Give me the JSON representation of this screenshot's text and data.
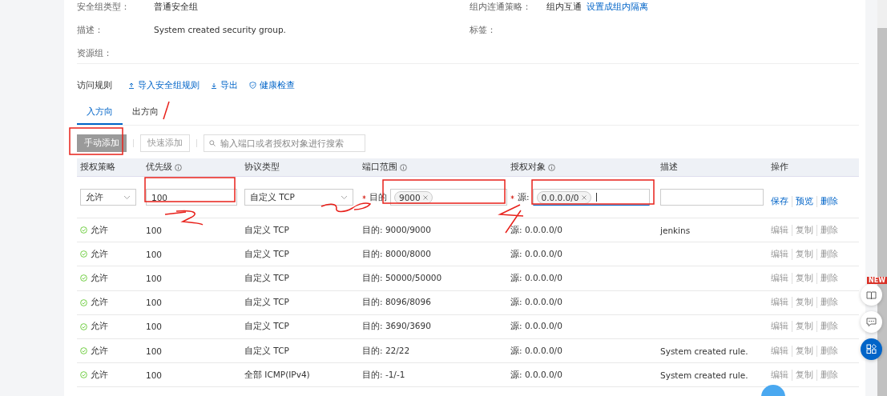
{
  "info": [
    {
      "label": "安全组类型：",
      "value": "普通安全组"
    },
    {
      "label": "组内连通策略：",
      "value": "组内互通",
      "link": "设置成组内隔离"
    },
    {
      "label": "描述：",
      "value": "System created security group."
    },
    {
      "label": "标签："
    },
    {
      "label": "资源组："
    }
  ],
  "rules": {
    "title": "访问规则",
    "actions": [
      {
        "kind": "upload",
        "label": "导入安全组规则"
      },
      {
        "kind": "download",
        "label": "导出"
      },
      {
        "kind": "shield",
        "label": "健康检查"
      }
    ]
  },
  "tabs": [
    {
      "label": "入方向",
      "selected": true
    },
    {
      "label": "出方向",
      "selected": false
    }
  ],
  "toolbar": {
    "buttons": [
      {
        "label": "手动添加",
        "disabled": true,
        "kind": "filled"
      },
      {
        "label": "快速添加",
        "disabled": true,
        "kind": "outline"
      }
    ],
    "search": {
      "placeholder": "输入端口或者授权对象进行搜索"
    }
  },
  "columns": [
    {
      "label": "授权策略",
      "info": false
    },
    {
      "label": "优先级",
      "info": true
    },
    {
      "label": "协议类型",
      "info": false
    },
    {
      "label": "端口范围",
      "info": true
    },
    {
      "label": "授权对象",
      "info": true
    },
    {
      "label": "描述",
      "info": false
    },
    {
      "label": "操作",
      "info": false
    }
  ],
  "edit_row": {
    "policy": "允许",
    "priority": "100",
    "protocol": "自定义 TCP",
    "port_required": true,
    "port_label": "目的",
    "source_required": true,
    "port_tag": "9000",
    "source_label": "源:",
    "source_tag": "0.0.0.0/0",
    "actions": [
      "保存",
      "预览",
      "删除"
    ]
  },
  "rows": [
    {
      "policy": "允许",
      "priority": "100",
      "protocol": "自定义 TCP",
      "port": "目的: 9000/9000",
      "source": "源: 0.0.0.0/0",
      "description": "jenkins",
      "actions": [
        {
          "label": "编辑",
          "disabled": true
        },
        {
          "label": "复制",
          "disabled": true
        },
        {
          "label": "删除",
          "disabled": true
        }
      ]
    },
    {
      "policy": "允许",
      "priority": "100",
      "protocol": "自定义 TCP",
      "port": "目的: 8000/8000",
      "source": "源: 0.0.0.0/0",
      "description": "",
      "actions": [
        {
          "label": "编辑",
          "disabled": true
        },
        {
          "label": "复制",
          "disabled": true
        },
        {
          "label": "删除",
          "disabled": true
        }
      ]
    },
    {
      "policy": "允许",
      "priority": "100",
      "protocol": "自定义 TCP",
      "port": "目的: 50000/50000",
      "source": "源: 0.0.0.0/0",
      "description": "",
      "actions": [
        {
          "label": "编辑",
          "disabled": true
        },
        {
          "label": "复制",
          "disabled": true
        },
        {
          "label": "删除",
          "disabled": true
        }
      ]
    },
    {
      "policy": "允许",
      "priority": "100",
      "protocol": "自定义 TCP",
      "port": "目的: 8096/8096",
      "source": "源: 0.0.0.0/0",
      "description": "",
      "actions": [
        {
          "label": "编辑",
          "disabled": true
        },
        {
          "label": "复制",
          "disabled": true
        },
        {
          "label": "删除",
          "disabled": true
        }
      ]
    },
    {
      "policy": "允许",
      "priority": "100",
      "protocol": "自定义 TCP",
      "port": "目的: 3690/3690",
      "source": "源: 0.0.0.0/0",
      "description": "",
      "actions": [
        {
          "label": "编辑",
          "disabled": true
        },
        {
          "label": "复制",
          "disabled": true
        },
        {
          "label": "删除",
          "disabled": true
        }
      ]
    },
    {
      "policy": "允许",
      "priority": "100",
      "protocol": "自定义 TCP",
      "port": "目的: 22/22",
      "source": "源: 0.0.0.0/0",
      "description": "System created rule.",
      "actions": [
        {
          "label": "编辑",
          "disabled": true
        },
        {
          "label": "复制",
          "disabled": true
        },
        {
          "label": "删除",
          "disabled": true
        }
      ]
    },
    {
      "policy": "允许",
      "priority": "100",
      "protocol": "全部 ICMP(IPv4)",
      "port": "目的: -1/-1",
      "source": "源: 0.0.0.0/0",
      "description": "System created rule.",
      "actions": [
        {
          "label": "编辑",
          "disabled": true
        },
        {
          "label": "复制",
          "disabled": true
        },
        {
          "label": "删除",
          "disabled": true
        }
      ]
    }
  ],
  "float_buttons": [
    {
      "kind": "book",
      "badge": "NEW",
      "active": false
    },
    {
      "kind": "chat",
      "active": false
    },
    {
      "kind": "apps",
      "active": true
    }
  ]
}
